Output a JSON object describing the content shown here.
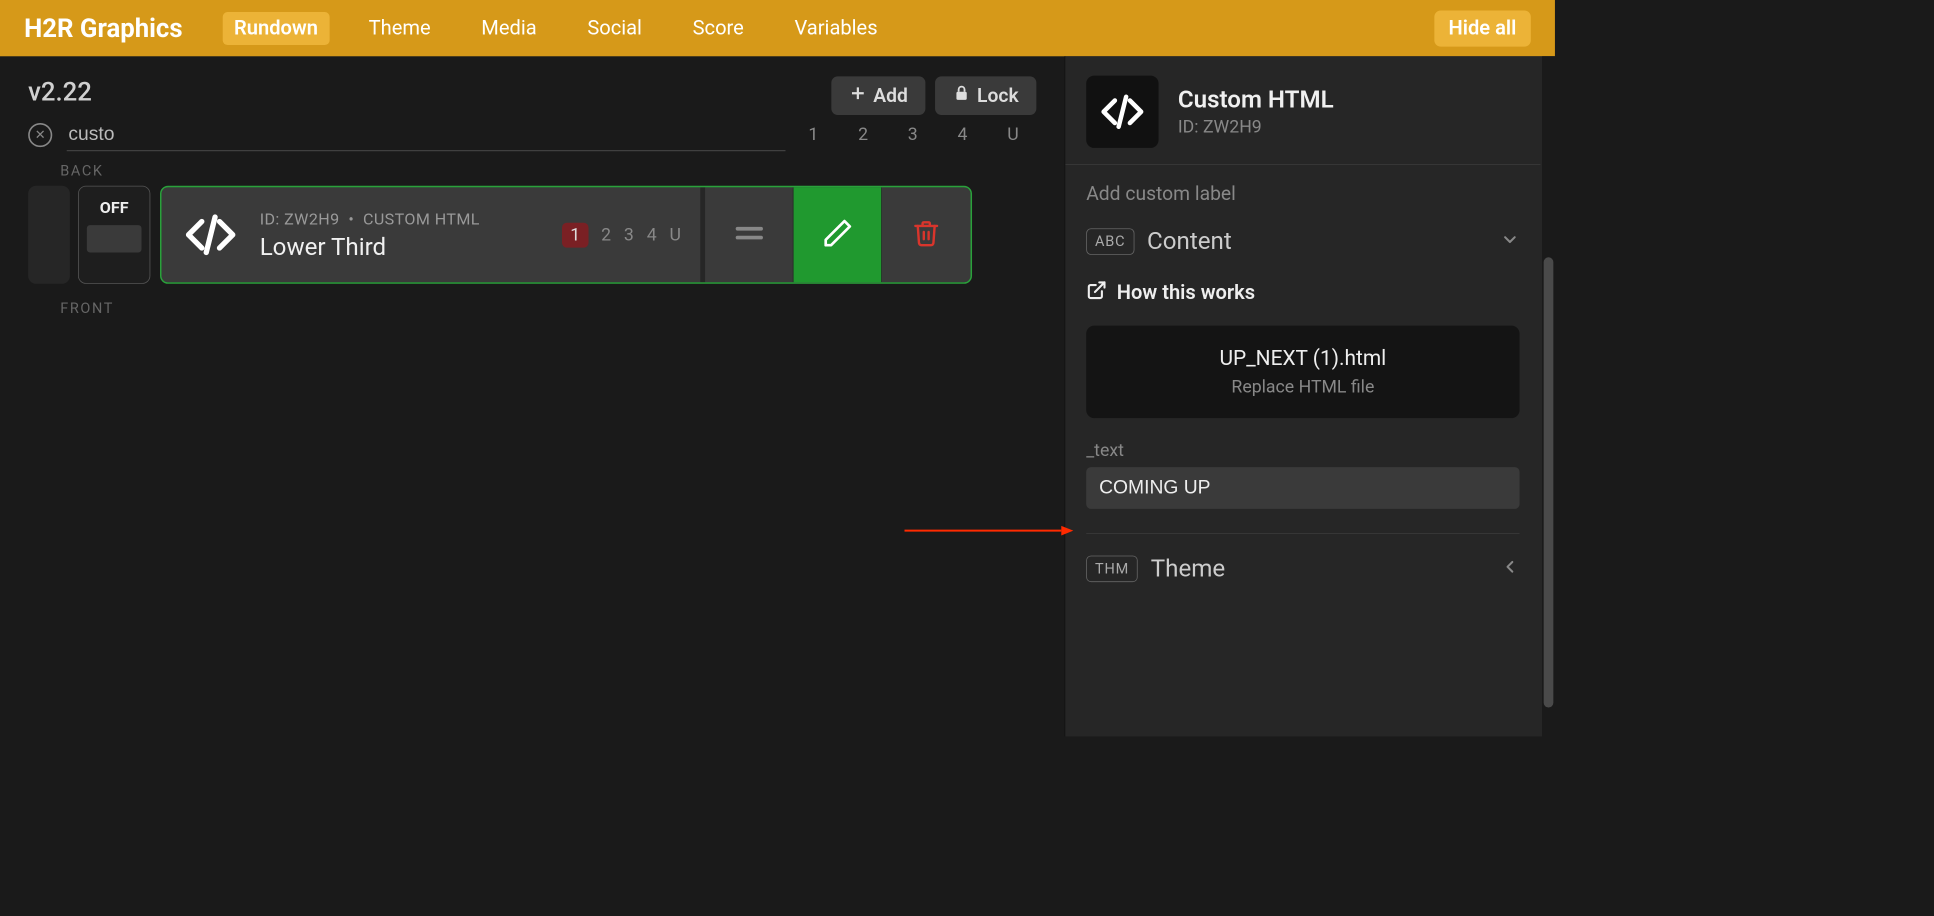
{
  "app_name": "H2R Graphics",
  "nav": {
    "items": [
      "Rundown",
      "Theme",
      "Media",
      "Social",
      "Score",
      "Variables"
    ],
    "active_index": 0
  },
  "hide_all_label": "Hide all",
  "version": "v2.22",
  "toolbar": {
    "add_label": "Add",
    "lock_label": "Lock"
  },
  "search": {
    "value": "custo"
  },
  "layer_header": "1   2   3   4   U",
  "section_back": "BACK",
  "section_front": "FRONT",
  "chip_off": "OFF",
  "rundown_item": {
    "id_prefix": "ID:",
    "id": "ZW2H9",
    "type": "CUSTOM HTML",
    "title": "Lower Third",
    "layers": [
      "1",
      "2",
      "3",
      "4",
      "U"
    ],
    "active_layer_index": 0
  },
  "sidebar": {
    "title": "Custom HTML",
    "id_prefix": "ID:",
    "id": "ZW2H9",
    "label_placeholder": "Add custom label",
    "content_badge": "ABC",
    "content_title": "Content",
    "how_link": "How this works",
    "file_name": "UP_NEXT (1).html",
    "file_sub": "Replace HTML file",
    "text_field_label": "_text",
    "text_field_value": "COMING UP",
    "theme_badge": "THM",
    "theme_title": "Theme"
  }
}
